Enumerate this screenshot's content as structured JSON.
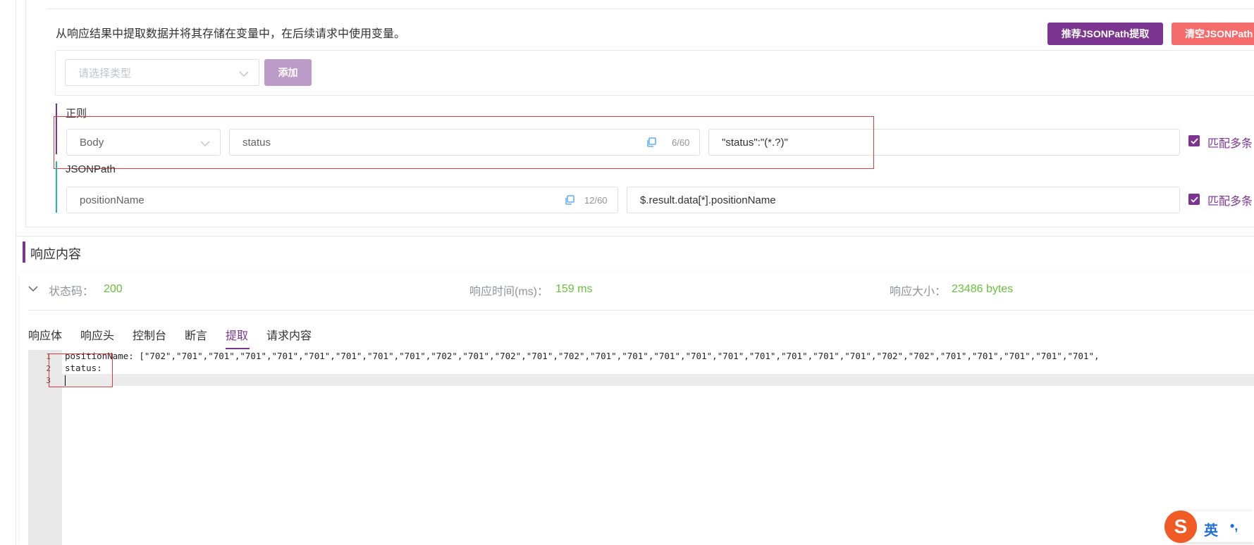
{
  "extract": {
    "description": "从响应结果中提取数据并将其存储在变量中，在后续请求中使用变量。",
    "recommend_button": "推荐JSONPath提取",
    "clear_button": "清空JSONPath",
    "type_select_placeholder": "请选择类型",
    "add_button": "添加",
    "regex": {
      "section_label": "正则",
      "source_value": "Body",
      "name_value": "status",
      "name_counter": "6/60",
      "expression_value": "\"status\":\"(*.?)\"",
      "match_multiple_label": "匹配多条"
    },
    "jsonpath": {
      "section_label": "JSONPath",
      "name_value": "positionName",
      "name_counter": "12/60",
      "expression_value": "$.result.data[*].positionName",
      "match_multiple_label": "匹配多条"
    }
  },
  "response": {
    "section_title": "响应内容",
    "status_code_label": "状态码：",
    "status_code_value": "200",
    "response_time_label": "响应时间(ms)：",
    "response_time_value": "159 ms",
    "response_size_label": "响应大小：",
    "response_size_value": "23486 bytes",
    "tabs": [
      {
        "label": "响应体",
        "active": false
      },
      {
        "label": "响应头",
        "active": false
      },
      {
        "label": "控制台",
        "active": false
      },
      {
        "label": "断言",
        "active": false
      },
      {
        "label": "提取",
        "active": true
      },
      {
        "label": "请求内容",
        "active": false
      }
    ],
    "editor": {
      "line_numbers": [
        "1",
        "2",
        "3"
      ],
      "lines": [
        "positionName: [\"702\",\"701\",\"701\",\"701\",\"701\",\"701\",\"701\",\"701\",\"701\",\"702\",\"701\",\"702\",\"701\",\"702\",\"701\",\"701\",\"701\",\"701\",\"701\",\"701\",\"701\",\"701\",\"701\",\"702\",\"702\",\"701\",\"701\",\"701\",\"701\",\"701\",",
        "status:",
        ""
      ]
    }
  },
  "ime": {
    "mode_label": "英",
    "punct_label": "•,"
  },
  "colors": {
    "brand_purple": "#7b3590",
    "danger_pink": "#f56c6c",
    "success_green": "#67c23a",
    "annotation_red": "#e33b3b"
  }
}
